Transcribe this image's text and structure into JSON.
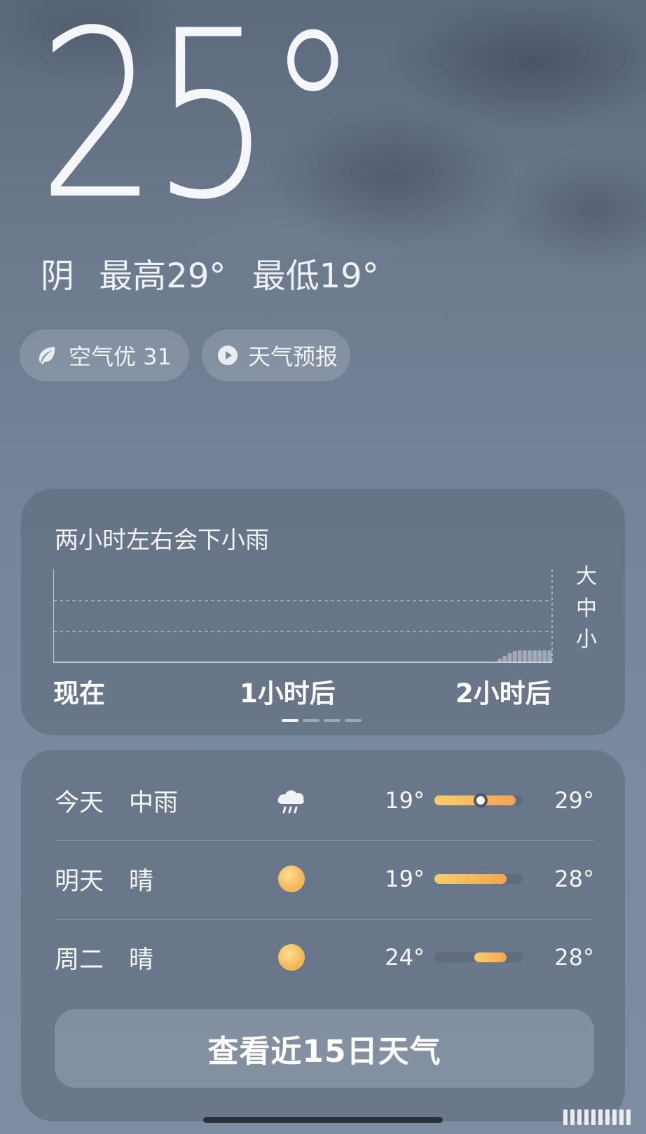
{
  "current": {
    "temperature": "25°",
    "condition": "阴",
    "high": "最高29°",
    "low": "最低19°"
  },
  "pills": {
    "air_quality": {
      "label": "空气优 31",
      "icon": "leaf-icon"
    },
    "forecast_video": {
      "label": "天气预报",
      "icon": "play-icon"
    }
  },
  "precipitation": {
    "headline": "两小时左右会下小雨",
    "levels": [
      "大",
      "中",
      "小"
    ],
    "time_labels": [
      "现在",
      "1小时后",
      "2小时后"
    ],
    "chart_data": {
      "type": "bar",
      "xlabel": "",
      "ylabel": "",
      "x_range_hours": [
        0,
        2
      ],
      "y_levels": [
        "小",
        "中",
        "大"
      ],
      "values_hint": "light rain beginning near 1.8h, rising to 小 level by 2h",
      "x": [
        1.79,
        1.81,
        1.83,
        1.85,
        1.87,
        1.89,
        1.91,
        1.93,
        1.95,
        1.97,
        1.99
      ],
      "values": [
        0.04,
        0.07,
        0.1,
        0.12,
        0.13,
        0.13,
        0.13,
        0.13,
        0.13,
        0.13,
        0.13
      ],
      "ylim": [
        0,
        1
      ]
    },
    "page_dots": 4,
    "active_dot": 0
  },
  "forecast": {
    "days": [
      {
        "day": "今天",
        "condition": "中雨",
        "icon": "rain-cloud-icon",
        "low": "19°",
        "high": "29°",
        "range_start": 0.0,
        "range_end": 0.92,
        "current_pos": 0.52
      },
      {
        "day": "明天",
        "condition": "晴",
        "icon": "sun-icon",
        "low": "19°",
        "high": "28°",
        "range_start": 0.0,
        "range_end": 0.82,
        "current_pos": null
      },
      {
        "day": "周二",
        "condition": "晴",
        "icon": "sun-icon",
        "low": "24°",
        "high": "28°",
        "range_start": 0.45,
        "range_end": 0.82,
        "current_pos": null
      }
    ],
    "cta_label": "查看近15日天气"
  },
  "colors": {
    "bar_start": "#f3cf6a",
    "bar_end": "#f3a552",
    "sun": "#f7c46a"
  }
}
